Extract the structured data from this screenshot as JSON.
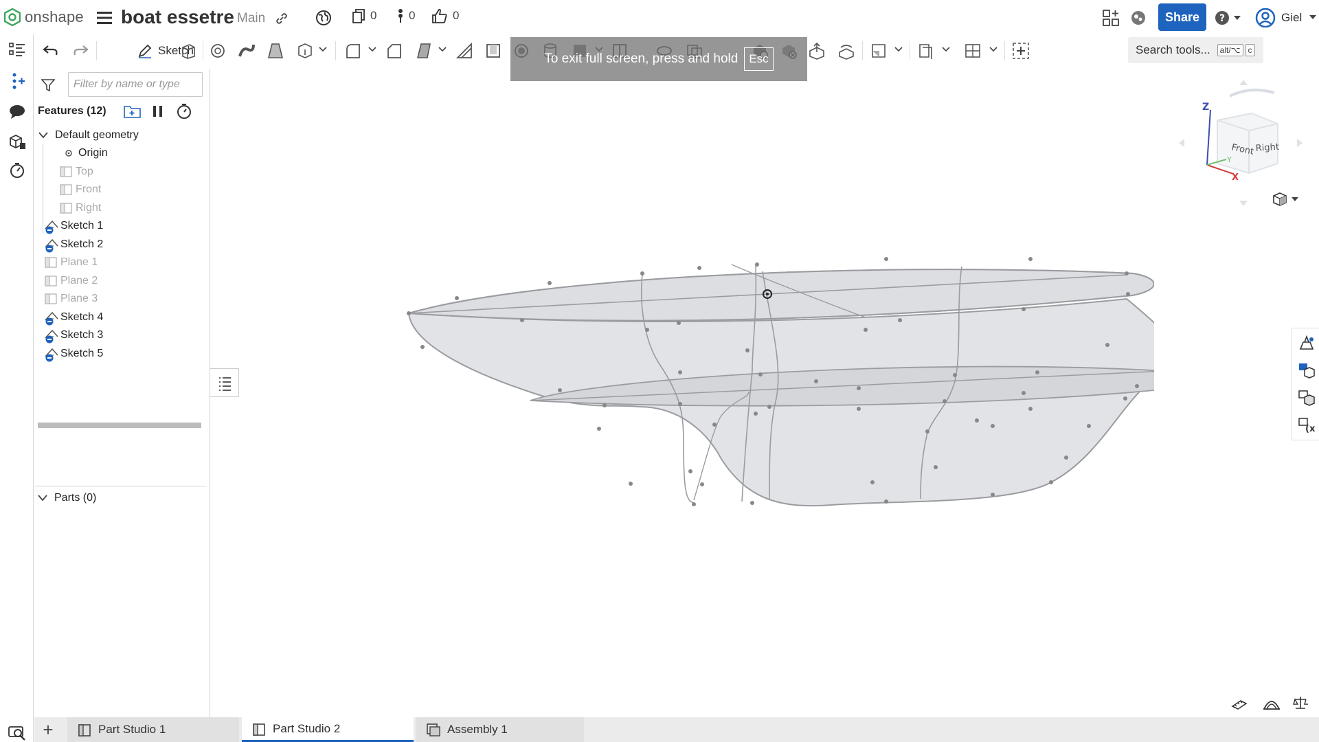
{
  "app": {
    "brand": "onshape"
  },
  "document": {
    "title": "boat essetre",
    "branch": "Main"
  },
  "header": {
    "versions_count": "0",
    "branches_count": "0",
    "likes_count": "0",
    "share_label": "Share",
    "user_name": "Giel"
  },
  "toolbar": {
    "sketch_label": "Sketch",
    "search_label": "Search tools...",
    "search_shortcut_key1": "alt/⌥",
    "search_shortcut_key2": "c"
  },
  "fullscreen_notice": {
    "text": "To exit full screen, press and hold",
    "key": "Esc"
  },
  "feature_panel": {
    "filter_placeholder": "Filter by name or type",
    "features_title": "Features (12)",
    "default_geometry_label": "Default geometry",
    "items": [
      {
        "label": "Origin",
        "icon": "origin-icon",
        "dim": false
      },
      {
        "label": "Top",
        "icon": "plane-icon",
        "dim": true
      },
      {
        "label": "Front",
        "icon": "plane-icon",
        "dim": true
      },
      {
        "label": "Right",
        "icon": "plane-icon",
        "dim": true
      },
      {
        "label": "Sketch 1",
        "icon": "sketch-icon",
        "dim": false
      },
      {
        "label": "Sketch 2",
        "icon": "sketch-icon",
        "dim": false
      },
      {
        "label": "Plane 1",
        "icon": "plane-icon",
        "dim": true
      },
      {
        "label": "Plane 2",
        "icon": "plane-icon",
        "dim": true
      },
      {
        "label": "Plane 3",
        "icon": "plane-icon",
        "dim": true
      },
      {
        "label": "Sketch 4",
        "icon": "sketch-icon",
        "dim": false
      },
      {
        "label": "Sketch 3",
        "icon": "sketch-icon",
        "dim": false
      },
      {
        "label": "Sketch 5",
        "icon": "sketch-icon",
        "dim": false
      }
    ],
    "parts_label": "Parts (0)"
  },
  "view_cube": {
    "front_label": "Front",
    "right_label": "Right",
    "axis_z": "Z",
    "axis_x": "X",
    "axis_y": "Y"
  },
  "tabs": [
    {
      "label": "Part Studio 1",
      "active": false
    },
    {
      "label": "Part Studio 2",
      "active": true
    },
    {
      "label": "Assembly 1",
      "active": false
    }
  ],
  "colors": {
    "accent": "#1e63bd",
    "sketch_badge": "#1e63bd",
    "axis_x": "#d43b3b",
    "axis_z": "#3a4fb0"
  }
}
